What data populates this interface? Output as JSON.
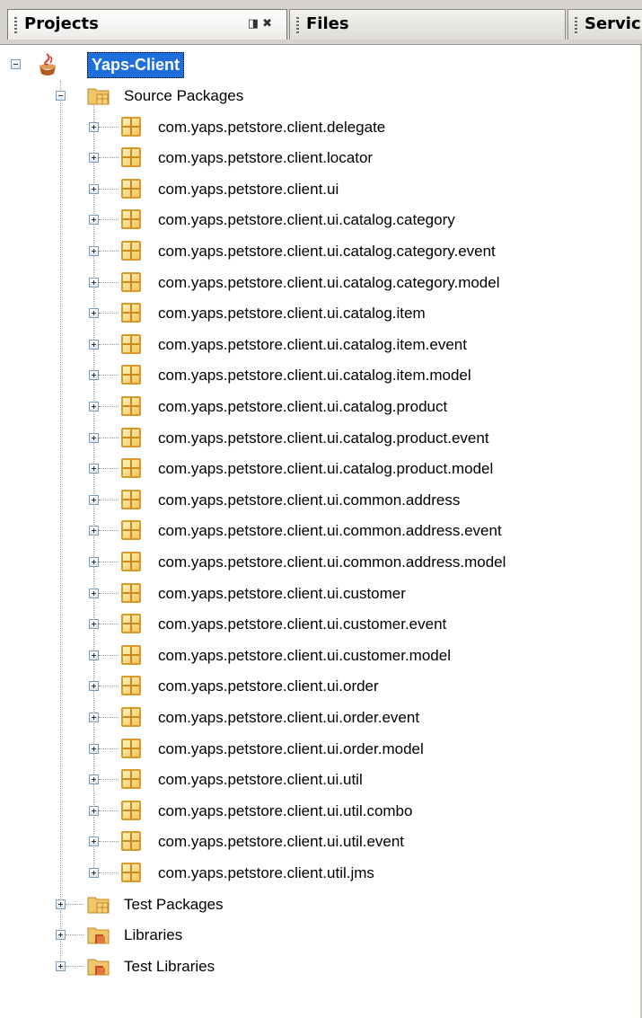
{
  "tabs": [
    {
      "label": "Projects",
      "active": true
    },
    {
      "label": "Files",
      "active": false
    },
    {
      "label": "Servic",
      "active": false
    }
  ],
  "tab_tools": {
    "minimize_icon": "minimize-icon",
    "close_icon": "close-icon"
  },
  "tree": {
    "root": {
      "label": "Yaps-Client",
      "expanded": true
    },
    "source_packages": {
      "label": "Source Packages",
      "expanded": true,
      "packages": [
        "com.yaps.petstore.client.delegate",
        "com.yaps.petstore.client.locator",
        "com.yaps.petstore.client.ui",
        "com.yaps.petstore.client.ui.catalog.category",
        "com.yaps.petstore.client.ui.catalog.category.event",
        "com.yaps.petstore.client.ui.catalog.category.model",
        "com.yaps.petstore.client.ui.catalog.item",
        "com.yaps.petstore.client.ui.catalog.item.event",
        "com.yaps.petstore.client.ui.catalog.item.model",
        "com.yaps.petstore.client.ui.catalog.product",
        "com.yaps.petstore.client.ui.catalog.product.event",
        "com.yaps.petstore.client.ui.catalog.product.model",
        "com.yaps.petstore.client.ui.common.address",
        "com.yaps.petstore.client.ui.common.address.event",
        "com.yaps.petstore.client.ui.common.address.model",
        "com.yaps.petstore.client.ui.customer",
        "com.yaps.petstore.client.ui.customer.event",
        "com.yaps.petstore.client.ui.customer.model",
        "com.yaps.petstore.client.ui.order",
        "com.yaps.petstore.client.ui.order.event",
        "com.yaps.petstore.client.ui.order.model",
        "com.yaps.petstore.client.ui.util",
        "com.yaps.petstore.client.ui.util.combo",
        "com.yaps.petstore.client.ui.util.event",
        "com.yaps.petstore.client.util.jms"
      ]
    },
    "other_nodes": [
      {
        "label": "Test Packages",
        "icon": "test-packages-folder-icon"
      },
      {
        "label": "Libraries",
        "icon": "libraries-folder-icon"
      },
      {
        "label": "Test Libraries",
        "icon": "test-libraries-folder-icon"
      }
    ]
  },
  "colors": {
    "selection": "#1e6fdc",
    "tab_bar": "#d6d3ce",
    "package_icon": "#f4c65a"
  }
}
